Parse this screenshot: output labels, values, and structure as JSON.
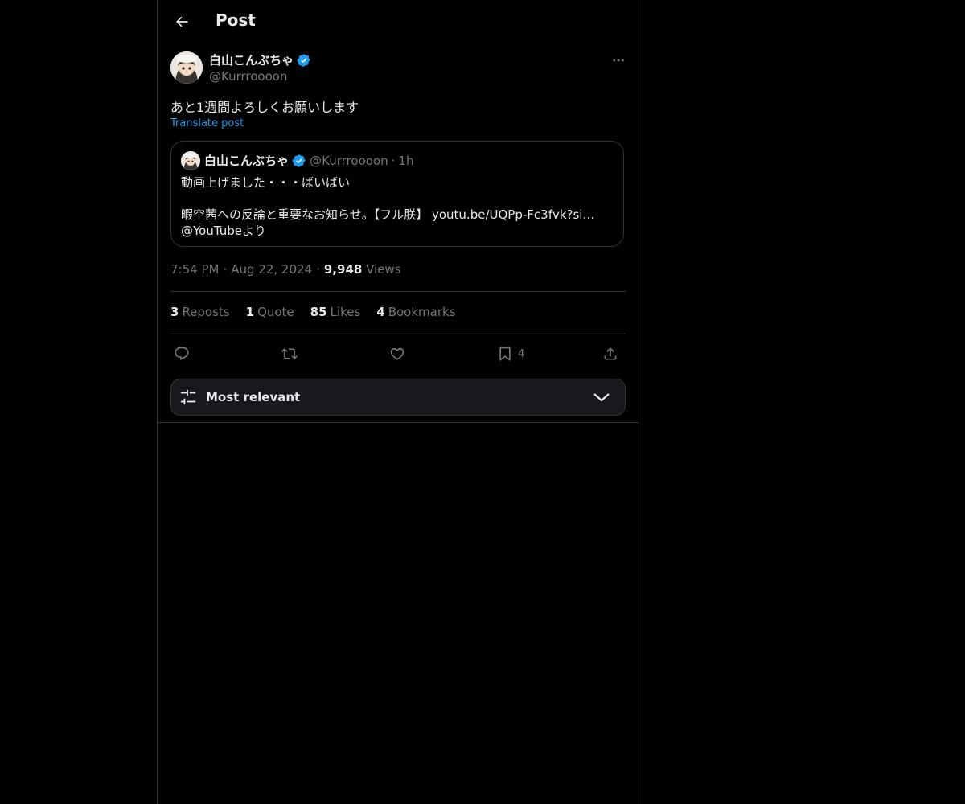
{
  "header": {
    "title": "Post"
  },
  "post": {
    "author_name": "白山こんぶちゃ",
    "author_handle": "@Kurrroooon",
    "text": "あと1週間よろしくお願いします",
    "translate_label": "Translate post",
    "time": "7:54 PM",
    "date": "Aug 22, 2024",
    "views_count": "9,948",
    "views_label": "Views"
  },
  "quote": {
    "author_name": "白山こんぶちゃ",
    "author_handle": "@Kurrroooon",
    "separator": "·",
    "time": "1h",
    "line1": "動画上げました・・・ばいばい",
    "line2_text": "暇空茜への反論と重要なお知らせ。【フル朕】 ",
    "line2_link": "youtu.be/UQPp-Fc3fvk?si…",
    "line3": "@YouTubeより"
  },
  "stats": {
    "reposts_count": "3",
    "reposts_label": "Reposts",
    "quotes_count": "1",
    "quotes_label": "Quote",
    "likes_count": "85",
    "likes_label": "Likes",
    "bookmarks_count": "4",
    "bookmarks_label": "Bookmarks"
  },
  "actions": {
    "bookmark_count": "4"
  },
  "sort": {
    "label": "Most relevant"
  },
  "colors": {
    "background": "#000000",
    "accent": "#1d9bf0",
    "verified": "#1d9bf0",
    "muted_text": "#71767b",
    "border": "#2f3336"
  },
  "icons": [
    "back-arrow-icon",
    "verified-badge-icon",
    "more-icon",
    "reply-icon",
    "repost-icon",
    "like-icon",
    "bookmark-icon",
    "share-icon",
    "sort-filter-icon",
    "chevron-down-icon"
  ]
}
